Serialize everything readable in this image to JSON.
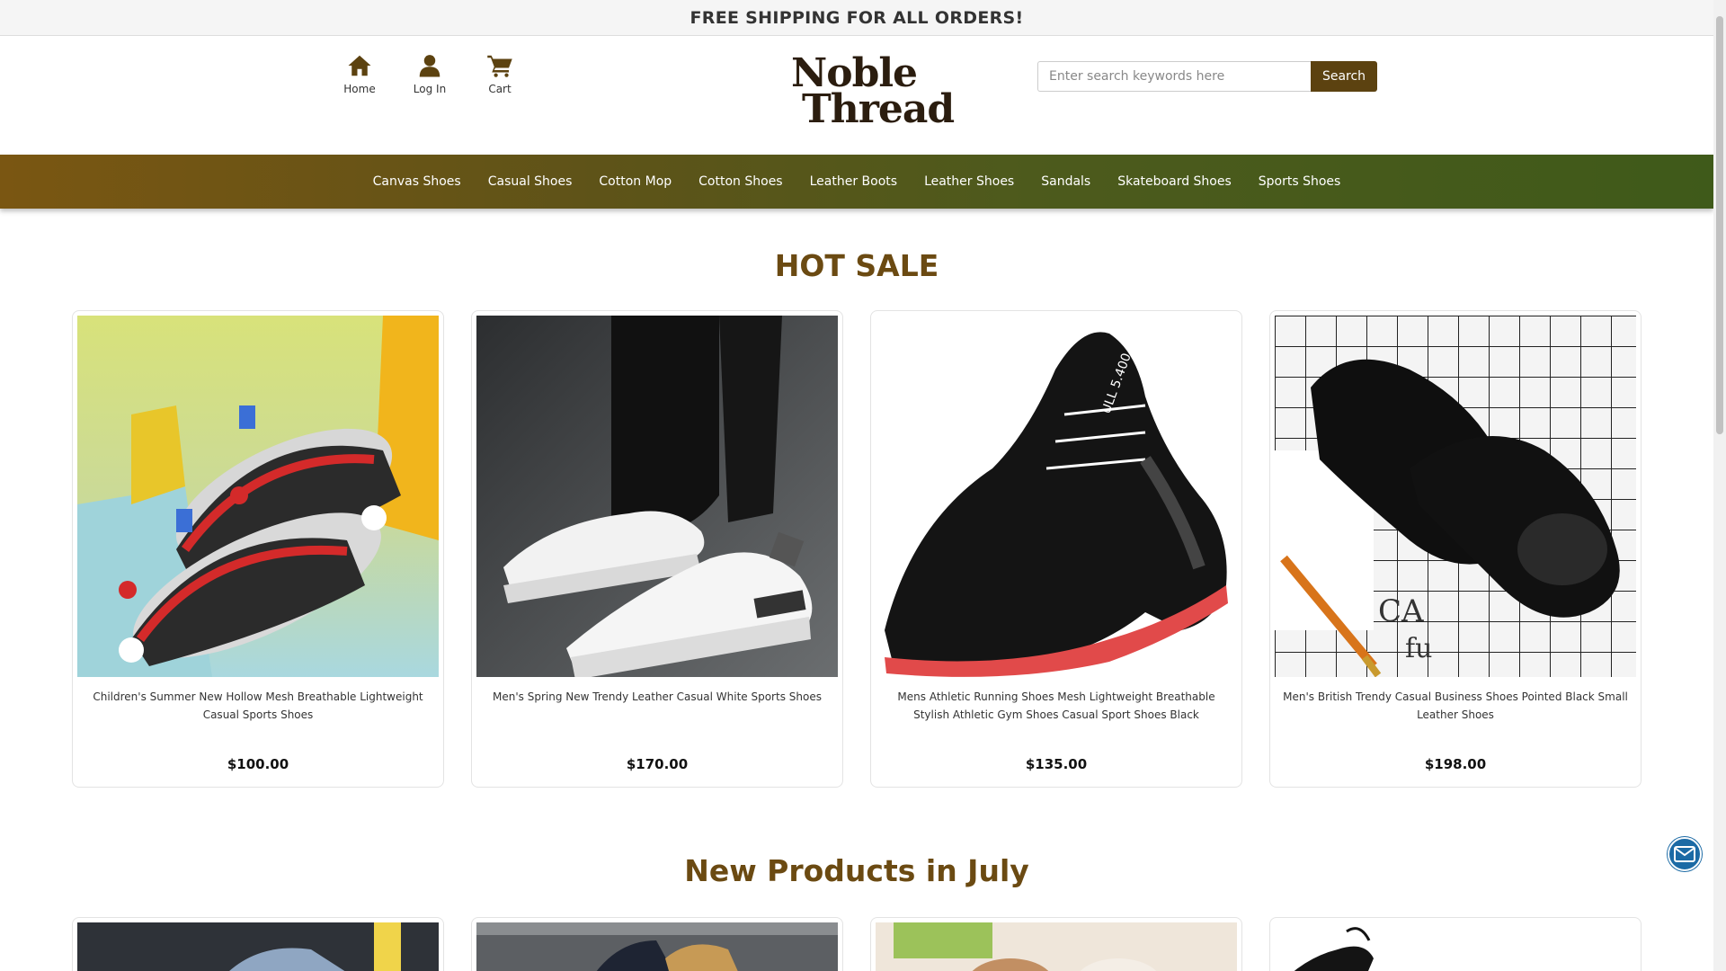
{
  "topbar": {
    "text": "FREE SHIPPING FOR ALL ORDERS!"
  },
  "nav": {
    "home": "Home",
    "login": "Log In",
    "cart": "Cart"
  },
  "logo": {
    "line1": "Noble",
    "line2": "Thread"
  },
  "search": {
    "placeholder": "Enter search keywords here",
    "button": "Search"
  },
  "categories": [
    "Canvas Shoes",
    "Casual Shoes",
    "Cotton Mop",
    "Cotton Shoes",
    "Leather Boots",
    "Leather Shoes",
    "Sandals",
    "Skateboard Shoes",
    "Sports Shoes"
  ],
  "hot_sale": {
    "title": "HOT SALE",
    "products": [
      {
        "title": "Children's Summer New Hollow Mesh Breathable Lightweight Casual Sports Shoes",
        "price": "$100.00"
      },
      {
        "title": "Men's Spring New Trendy Leather Casual White Sports Shoes",
        "price": "$170.00"
      },
      {
        "title": "Mens Athletic Running Shoes Mesh Lightweight Breathable Stylish Athletic Gym Shoes Casual Sport Shoes Black",
        "price": "$135.00"
      },
      {
        "title": "Men's British Trendy Casual Business Shoes Pointed Black Small Leather Shoes",
        "price": "$198.00"
      }
    ]
  },
  "new_products": {
    "title": "New Products in July"
  },
  "colors": {
    "accent": "#6b4a12",
    "nav_start": "#7a5612",
    "nav_end": "#3f5a1a",
    "fab": "#1b6aa5"
  }
}
